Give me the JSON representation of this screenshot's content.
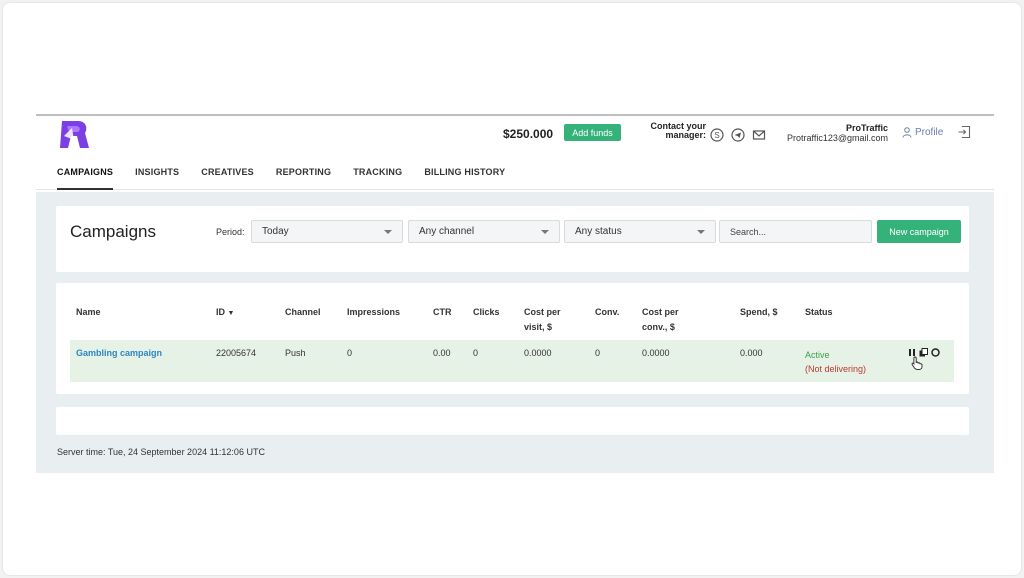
{
  "header": {
    "balance": "$250.000",
    "add_funds_label": "Add funds",
    "contact_line1": "Contact your",
    "contact_line2": "manager:",
    "contact_icons": [
      "skype-icon",
      "telegram-icon",
      "mail-icon"
    ],
    "user_name": "ProTraffic",
    "user_email": "Protraffic123@gmail.com",
    "profile_label": "Profile"
  },
  "nav": {
    "items": [
      "CAMPAIGNS",
      "INSIGHTS",
      "CREATIVES",
      "REPORTING",
      "TRACKING",
      "BILLING HISTORY"
    ],
    "active": "CAMPAIGNS"
  },
  "filters": {
    "title": "Campaigns",
    "period_label": "Period:",
    "period_value": "Today",
    "channel_value": "Any channel",
    "status_value": "Any status",
    "search_placeholder": "Search...",
    "new_campaign_label": "New campaign"
  },
  "table": {
    "headers": {
      "name": "Name",
      "id": "ID",
      "channel": "Channel",
      "impressions": "Impressions",
      "ctr": "CTR",
      "clicks": "Clicks",
      "cpv_line1": "Cost per",
      "cpv_line2": "visit, $",
      "conv": "Conv.",
      "cpc_line1": "Cost per",
      "cpc_line2": "conv., $",
      "spend": "Spend, $",
      "status": "Status"
    },
    "rows": [
      {
        "name": "Gambling campaign",
        "id": "22005674",
        "channel": "Push",
        "impressions": "0",
        "ctr": "0.00",
        "clicks": "0",
        "cost_per_visit": "0.0000",
        "conv": "0",
        "cost_per_conv": "0.0000",
        "spend": "0.000",
        "status": "Active",
        "status_note": "(Not delivering)"
      }
    ]
  },
  "footer": {
    "server_time": "Server time: Tue, 24 September 2024 11:12:06 UTC"
  },
  "colors": {
    "accent_green": "#35b27a",
    "link_blue": "#2b86c5",
    "logo_purple": "#7b3fe4",
    "row_highlight": "#e6f2e6"
  }
}
